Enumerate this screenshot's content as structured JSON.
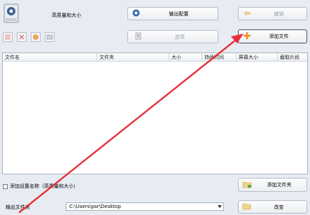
{
  "top": {
    "quality_label": "高质量和大小",
    "output_config_label": "输出配置",
    "undo_label": "撤销",
    "options_label": "选项",
    "add_file_label": "添加文件"
  },
  "table": {
    "columns": [
      "文件名",
      "文件夹",
      "大小",
      "持续时间",
      "屏幕大小",
      "截取片段"
    ]
  },
  "bottom": {
    "checkbox_label": "添加设置名称（高质量和大小）",
    "add_folder_label": "添加文件夹",
    "output_folder_label": "输出文件夹",
    "output_path": "C:\\Users\\psr\\Desktop",
    "change_label": "改变"
  },
  "colors": {
    "annotation_arrow": "#e8303a",
    "accent_orange": "#f08a1c"
  }
}
